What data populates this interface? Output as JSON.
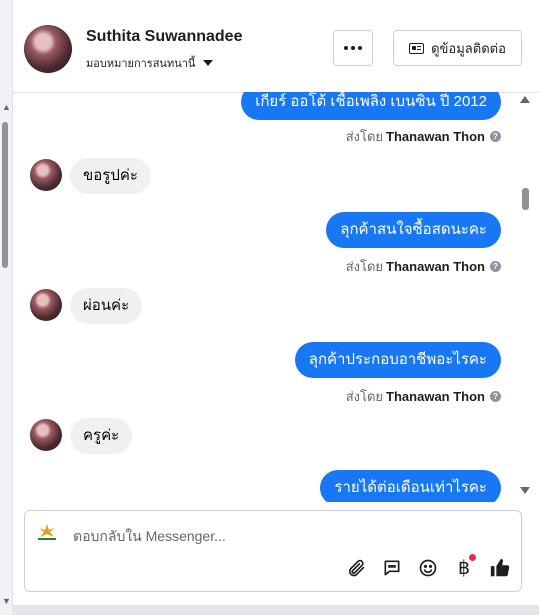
{
  "header": {
    "contact_name": "Suthita Suwannadee",
    "assign_label": "มอบหมายการสนทนานี้",
    "more_button_label": "…",
    "contact_info_button_label": "ดูข้อมูลติดต่อ"
  },
  "messages": [
    {
      "direction": "out",
      "text": "เกียร์ ออโต้  เชื้อเพลิง เบนซิน  ปี 2012"
    },
    {
      "direction": "out_meta",
      "prefix": "ส่งโดย",
      "sender": "Thanawan Thon"
    },
    {
      "direction": "in",
      "text": "ขอรูปค่ะ"
    },
    {
      "direction": "out",
      "text": "ลุกค้าสนใจซื้อสดนะคะ"
    },
    {
      "direction": "out_meta",
      "prefix": "ส่งโดย",
      "sender": "Thanawan Thon"
    },
    {
      "direction": "in",
      "text": "ผ่อนค่ะ"
    },
    {
      "direction": "out",
      "text": "ลุกค้าประกอบอาชีพอะไรคะ"
    },
    {
      "direction": "out_meta",
      "prefix": "ส่งโดย",
      "sender": "Thanawan Thon"
    },
    {
      "direction": "in",
      "text": "ครูค่ะ"
    },
    {
      "direction": "out",
      "text": "รายได้ต่อเดือนเท่าไรคะ"
    }
  ],
  "composer": {
    "placeholder": "ตอบกลับใน Messenger...",
    "tools": [
      "paperclip-icon",
      "saved-reply-icon",
      "emoji-icon",
      "baht-payment-icon",
      "like-icon"
    ],
    "baht_symbol": "฿"
  },
  "colors": {
    "outgoing_bubble": "#1877f2",
    "incoming_bubble": "#f0f0f0",
    "notification_dot": "#f02849"
  }
}
